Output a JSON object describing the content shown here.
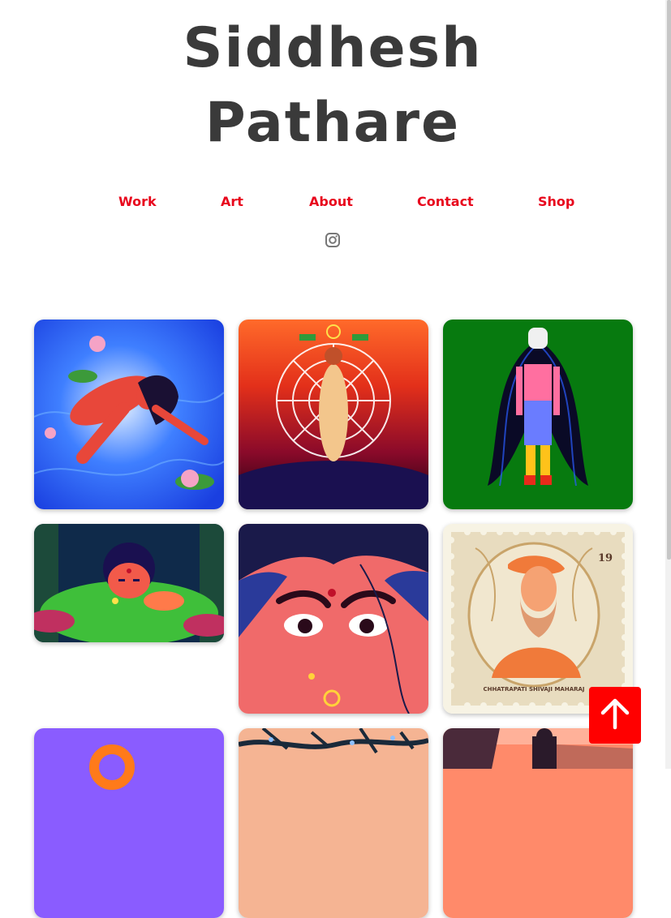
{
  "site": {
    "title_line1": "Siddhesh",
    "title_line2": "Pathare"
  },
  "nav": {
    "items": [
      {
        "label": "Work"
      },
      {
        "label": "Art"
      },
      {
        "label": "About"
      },
      {
        "label": "Contact"
      },
      {
        "label": "Shop"
      }
    ]
  },
  "social": {
    "icon": "instagram-icon"
  },
  "gallery": {
    "items": [
      {
        "subject": "woman floating in lotus pond"
      },
      {
        "subject": "figure bound in spider web"
      },
      {
        "subject": "masked figure with long hair"
      },
      {
        "subject": "giant woman looking over forest clearing"
      },
      {
        "subject": "close-up face with nose ring"
      },
      {
        "subject": "postage stamp portrait",
        "stamp_number": "19",
        "stamp_caption": "CHHATRAPATI SHIVAJI MAHARAJ"
      },
      {
        "subject": "orange sun on purple"
      },
      {
        "subject": "branches on peach sky"
      },
      {
        "subject": "sunset scene"
      }
    ]
  },
  "colors": {
    "accent": "#e8071d",
    "title": "#3a3a3a",
    "back_to_top": "#ff0000"
  },
  "back_to_top": {
    "icon": "arrow-up-icon"
  }
}
